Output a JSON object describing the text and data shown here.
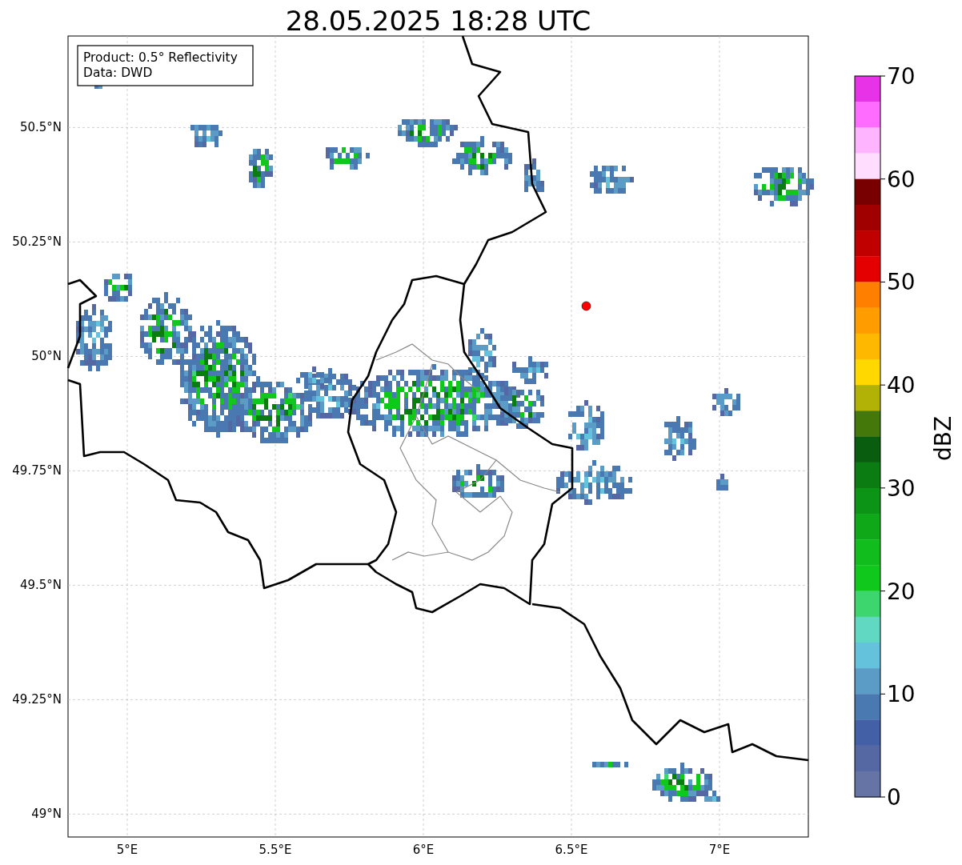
{
  "map": {
    "chart_data": {
      "type": "scatter",
      "title": "28.05.2025 18:28 UTC",
      "xlim": [
        4.8,
        7.3
      ],
      "ylim": [
        48.95,
        50.7
      ],
      "grid": true,
      "xticks": [
        {
          "value": 5,
          "label": "5°E"
        },
        {
          "value": 5.5,
          "label": "5.5°E"
        },
        {
          "value": 6,
          "label": "6°E"
        },
        {
          "value": 6.5,
          "label": "6.5°E"
        },
        {
          "value": 7,
          "label": "7°E"
        }
      ],
      "yticks": [
        {
          "value": 50.5,
          "label": "50.5°N"
        },
        {
          "value": 50.25,
          "label": "50.25°N"
        },
        {
          "value": 50,
          "label": "50°N"
        },
        {
          "value": 49.75,
          "label": "49.75°N"
        },
        {
          "value": 49.5,
          "label": "49.5°N"
        },
        {
          "value": 49.25,
          "label": "49.25°N"
        },
        {
          "value": 49,
          "label": "49°N"
        }
      ],
      "x": [
        6.55
      ],
      "series": [
        {
          "color": "#ff0000",
          "values": [
            50.11
          ]
        }
      ]
    },
    "legend": [
      "Product: 0.5° Reflectivity",
      "Data: DWD"
    ]
  },
  "colorbar": {
    "label": "dBZ",
    "ticks": [
      "70",
      "60",
      "50",
      "40",
      "30",
      "20",
      "10",
      "0"
    ],
    "bins": [
      {
        "color": "#e832e8"
      },
      {
        "color": "#ff6cff"
      },
      {
        "color": "#ffb4ff"
      },
      {
        "color": "#ffddff"
      },
      {
        "color": "#780000"
      },
      {
        "color": "#a00000"
      },
      {
        "color": "#c00000"
      },
      {
        "color": "#e40000"
      },
      {
        "color": "#ff8000"
      },
      {
        "color": "#ff9c00"
      },
      {
        "color": "#ffb800"
      },
      {
        "color": "#ffd800"
      },
      {
        "color": "#b2b206"
      },
      {
        "color": "#44780a"
      },
      {
        "color": "#085e0e"
      },
      {
        "color": "#0a7c12"
      },
      {
        "color": "#0c9416"
      },
      {
        "color": "#0ea818"
      },
      {
        "color": "#10bd1c"
      },
      {
        "color": "#10c81c"
      },
      {
        "color": "#3cd56e"
      },
      {
        "color": "#60d8c2"
      },
      {
        "color": "#65c2dc"
      },
      {
        "color": "#5b9cc6"
      },
      {
        "color": "#4a78b0"
      },
      {
        "color": "#435fa5"
      },
      {
        "color": "#5668a3"
      },
      {
        "color": "#6673a5"
      }
    ]
  }
}
